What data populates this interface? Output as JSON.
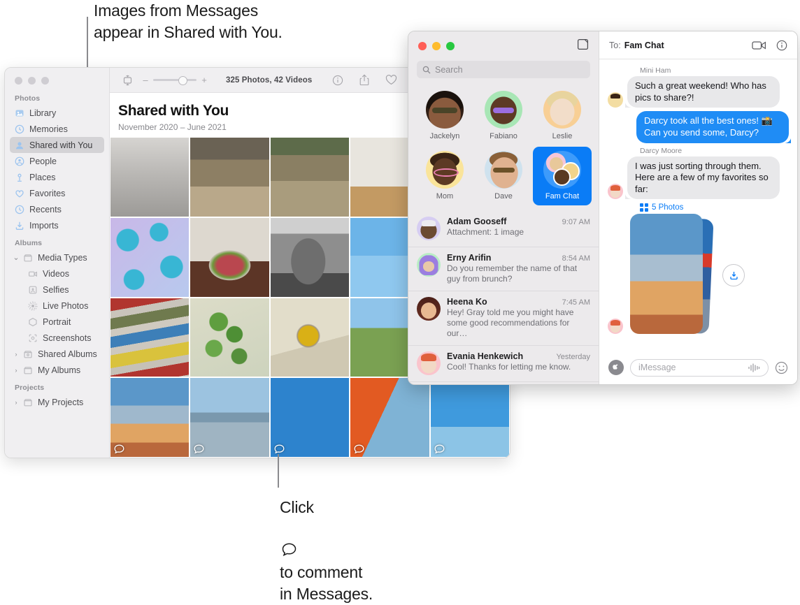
{
  "callouts": {
    "top": "Images from Messages\nappear in Shared with You.",
    "bottom_before": "Click",
    "bottom_after": "to comment\nin Messages."
  },
  "photos_app": {
    "toolbar": {
      "view_icon": "display-icon",
      "zoom_minus": "–",
      "zoom_plus": "+",
      "count_label": "325 Photos, 42 Videos",
      "info_icon": "info-icon",
      "share_icon": "share-icon",
      "favorite_icon": "heart-icon",
      "rotate_icon": "rotate-icon"
    },
    "header": {
      "title": "Shared with You",
      "subtitle": "November 2020 – June 2021"
    },
    "sidebar": {
      "groups": [
        {
          "title": "Photos",
          "items": [
            {
              "label": "Library",
              "icon": "library-icon",
              "selected": false
            },
            {
              "label": "Memories",
              "icon": "memories-icon",
              "selected": false
            },
            {
              "label": "Shared with You",
              "icon": "shared-icon",
              "selected": true
            },
            {
              "label": "People",
              "icon": "people-icon",
              "selected": false
            },
            {
              "label": "Places",
              "icon": "places-icon",
              "selected": false
            },
            {
              "label": "Favorites",
              "icon": "heart-icon",
              "selected": false
            },
            {
              "label": "Recents",
              "icon": "clock-icon",
              "selected": false
            },
            {
              "label": "Imports",
              "icon": "import-icon",
              "selected": false
            }
          ]
        },
        {
          "title": "Albums",
          "items": [
            {
              "label": "Media Types",
              "icon": "folder-icon",
              "disclosure": "down",
              "child": false
            },
            {
              "label": "Videos",
              "icon": "video-icon",
              "child": true
            },
            {
              "label": "Selfies",
              "icon": "selfie-icon",
              "child": true
            },
            {
              "label": "Live Photos",
              "icon": "live-photo-icon",
              "child": true
            },
            {
              "label": "Portrait",
              "icon": "portrait-icon",
              "child": true
            },
            {
              "label": "Screenshots",
              "icon": "screenshot-icon",
              "child": true
            },
            {
              "label": "Shared Albums",
              "icon": "shared-album-icon",
              "disclosure": "right",
              "child": false
            },
            {
              "label": "My Albums",
              "icon": "folder-icon",
              "disclosure": "right",
              "child": false
            }
          ]
        },
        {
          "title": "Projects",
          "items": [
            {
              "label": "My Projects",
              "icon": "folder-icon",
              "disclosure": "right",
              "child": false
            }
          ]
        }
      ]
    },
    "grid": {
      "comment_icon": "comment-bubble-icon",
      "cells": [
        {
          "name": "bw-silhouette-portrait",
          "has_comment": false
        },
        {
          "name": "child-yellow-float-river",
          "has_comment": false
        },
        {
          "name": "child-jumping-water",
          "has_comment": false
        },
        {
          "name": "man-sitting-floor",
          "has_comment": false
        },
        {
          "name": "woman-red-shirt-sitting",
          "has_comment": false
        },
        {
          "name": "blue-floral-fabric",
          "has_comment": false
        },
        {
          "name": "bowl-of-fruit",
          "has_comment": false
        },
        {
          "name": "bw-woman-curly-hair",
          "has_comment": false
        },
        {
          "name": "woman-red-pants-sky",
          "has_comment": false
        },
        {
          "name": "woman-orange-wrap",
          "has_comment": false
        },
        {
          "name": "stacked-colored-pipes",
          "has_comment": false
        },
        {
          "name": "green-leaves-branch",
          "has_comment": false
        },
        {
          "name": "yellow-bowl-on-table",
          "has_comment": false
        },
        {
          "name": "family-in-field",
          "has_comment": false
        },
        {
          "name": "woman-pink-dress-field",
          "has_comment": false
        },
        {
          "name": "woman-pink-top-sunset",
          "has_comment": true
        },
        {
          "name": "family-wading-in-sea",
          "has_comment": true
        },
        {
          "name": "boy-with-popsicle",
          "has_comment": true
        },
        {
          "name": "man-with-orange-umbrella",
          "has_comment": true
        },
        {
          "name": "boy-and-father-portrait",
          "has_comment": true
        }
      ]
    }
  },
  "messages_app": {
    "window_controls": {
      "close": "#ff5f57",
      "minimize": "#febc2e",
      "zoom": "#28c840"
    },
    "compose_icon": "compose-icon",
    "search": {
      "placeholder": "Search",
      "icon": "search-icon"
    },
    "pinned": [
      {
        "label": "Jackelyn",
        "selected": false,
        "avatar": "photo-woman-sunglasses"
      },
      {
        "label": "Fabiano",
        "selected": false,
        "avatar": "memoji-green-bg"
      },
      {
        "label": "Leslie",
        "selected": false,
        "avatar": "memoji-orange-bg"
      },
      {
        "label": "Mom",
        "selected": false,
        "avatar": "memoji-yellow-bg"
      },
      {
        "label": "Dave",
        "selected": false,
        "avatar": "photo-man-sunglasses"
      },
      {
        "label": "Fam Chat",
        "selected": true,
        "avatar": "group-avatar"
      }
    ],
    "conversations": [
      {
        "name": "Adam Gooseff",
        "time": "9:07 AM",
        "preview": "Attachment: 1 image",
        "avatar": "memoji-lavender-bg"
      },
      {
        "name": "Erny Arifin",
        "time": "8:54 AM",
        "preview": "Do you remember the name of that guy from brunch?",
        "avatar": "memoji-mint-bg"
      },
      {
        "name": "Heena Ko",
        "time": "7:45 AM",
        "preview": "Hey! Gray told me you might have some good recommendations for our…",
        "avatar": "photo-woman-bob"
      },
      {
        "name": "Evania Henkewich",
        "time": "Yesterday",
        "preview": "Cool! Thanks for letting me know.",
        "avatar": "memoji-pink-bg"
      }
    ],
    "thread": {
      "to_label": "To:",
      "to_name": "Fam Chat",
      "facetime_icon": "video-camera-icon",
      "info_icon": "info-icon",
      "messages": [
        {
          "sender": "Mini Ham",
          "side": "them",
          "text": "Such a great weekend! Who has pics to share?!",
          "avatar": "memoji-tan-bg"
        },
        {
          "sender": "",
          "side": "me",
          "text": "Darcy took all the best ones! 📸 Can you send some, Darcy?"
        },
        {
          "sender": "Darcy Moore",
          "side": "them",
          "text": "I was just sorting through them. Here are a few of my favorites so far:",
          "avatar": "memoji-pink-bg"
        }
      ],
      "attachment": {
        "label": "5 Photos",
        "grid_icon": "grid-icon",
        "download_icon": "download-icon",
        "avatar": "memoji-pink-bg"
      },
      "input": {
        "placeholder": "iMessage",
        "app_icon": "app-store-icon",
        "audio_icon": "audio-waveform-icon",
        "emoji_icon": "smiley-icon"
      }
    }
  },
  "colors": {
    "accent_blue": "#0a7cf6",
    "bubble_blue": "#1f8cf5",
    "bubble_gray": "#e8e8ea",
    "sidebar_bg": "#f0eff1",
    "messages_sidebar_bg": "#eceaec"
  }
}
